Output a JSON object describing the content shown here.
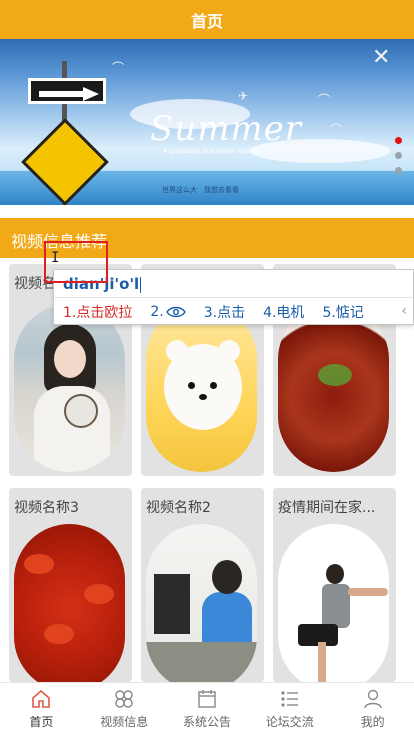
{
  "header": {
    "title": "首页"
  },
  "banner": {
    "headline": "Summer",
    "subline": "A guidebook to summer seaside",
    "caption": "世界这么大　我想去看看",
    "slides": 3,
    "active_slide": 1
  },
  "section": {
    "title": "视频信息推荐"
  },
  "cards": [
    {
      "title": "视频名称",
      "image": "hanfu-girl-photo"
    },
    {
      "title": "",
      "image": "white-puppy-photo"
    },
    {
      "title": "",
      "image": "braised-meat-photo"
    },
    {
      "title": "视频名称3",
      "image": "crayfish-photo"
    },
    {
      "title": "视频名称2",
      "image": "kid-at-computer-photo"
    },
    {
      "title": "疫情期间在家...",
      "image": "squat-exercise-photo"
    }
  ],
  "tabbar": [
    {
      "label": "首页",
      "icon": "home-icon",
      "active": true
    },
    {
      "label": "视频信息",
      "icon": "grid-icon",
      "active": false
    },
    {
      "label": "系统公告",
      "icon": "calendar-icon",
      "active": false
    },
    {
      "label": "论坛交流",
      "icon": "list-icon",
      "active": false
    },
    {
      "label": "我的",
      "icon": "user-icon",
      "active": false
    }
  ],
  "ime": {
    "composition": "dian'ji'o'l",
    "candidates": [
      "1.点击欧拉",
      "2.",
      "3.点击",
      "4.电机",
      "5.惦记"
    ],
    "candidate2_icon": "eye-icon"
  },
  "colors": {
    "accent": "#f2a917",
    "ime_blue": "#1b5dab",
    "ime_red": "#d52a2a"
  }
}
